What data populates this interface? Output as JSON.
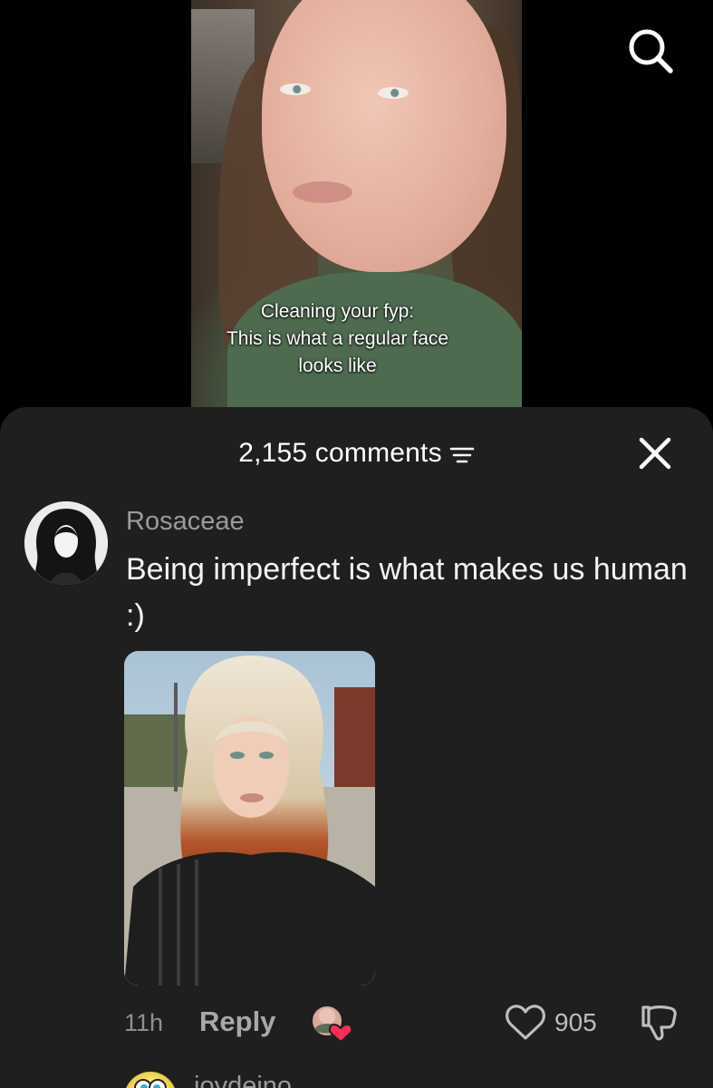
{
  "video": {
    "caption_lines": [
      "Cleaning your fyp:",
      "This is what a regular face",
      "looks like"
    ],
    "search_icon": "search-icon"
  },
  "comments_panel": {
    "count_label": "2,155 comments",
    "sort_icon": "sort-icon",
    "close_icon": "close-icon"
  },
  "comment": {
    "username": "Rosaceae",
    "text": "Being imperfect is what makes us human :)",
    "timestamp": "11h",
    "reply_label": "Reply",
    "like_count": "905",
    "icons": {
      "creator_liked": "creator-liked-avatar-icon",
      "like": "heart-icon",
      "dislike": "thumbs-down-icon"
    }
  },
  "next_comment": {
    "username": "joydeino"
  },
  "colors": {
    "sheet_background": "#1f1f1f",
    "muted_text": "#9b9b9b",
    "heart_badge": "#fe2c55"
  }
}
